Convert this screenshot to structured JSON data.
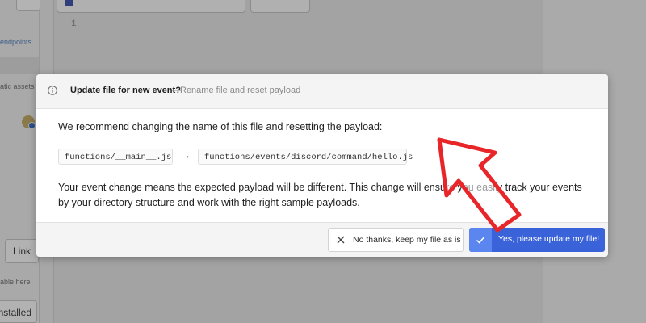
{
  "background": {
    "sidebar": {
      "endpoints_label": "endpoints",
      "static_assets_label": "atic assets",
      "link_button": "Link",
      "table_hint": "able here",
      "installed_button": "nstalled"
    },
    "editor": {
      "line_number": "1"
    }
  },
  "dialog": {
    "title": "Update file for new event?",
    "separator": "—",
    "subtitle": "Rename file and reset payload",
    "recommendation": "We recommend changing the name of this file and resetting the payload:",
    "old_path": "functions/__main__.js",
    "arrow": "→",
    "new_path": "functions/events/discord/command/hello.js",
    "explanation": "Your event change means the expected payload will be different. This change will ensure you easily track your events by your directory structure and work with the right sample payloads.",
    "decline_button": "No thanks, keep my file as is",
    "accept_button": "Yes, please update my file!"
  },
  "colors": {
    "primary": "#3b63d9",
    "primary_light": "#5b86f0",
    "annotation": "#e8262a"
  },
  "icons": {
    "header": "info-icon",
    "decline": "close-icon",
    "accept": "check-icon",
    "overlay": "red-arrow-annotation"
  }
}
